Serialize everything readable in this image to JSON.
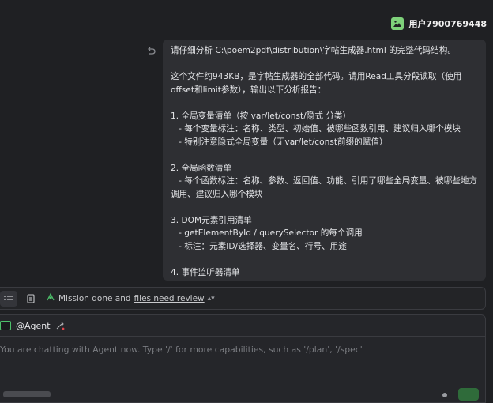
{
  "header": {
    "user_name": "用户7900769448",
    "avatar_icon": "image-icon"
  },
  "message": {
    "lines": [
      "请仔细分析 C:\\poem2pdf\\distribution\\字帖生成器.html 的完整代码结构。",
      "",
      "这个文件约943KB，是字帖生成器的全部代码。请用Read工具分段读取（使用offset和limit参数），输出以下分析报告：",
      "",
      "1. 全局变量清单（按 var/let/const/隐式 分类）",
      "   - 每个变量标注：名称、类型、初始值、被哪些函数引用、建议归入哪个模块",
      "   - 特别注意隐式全局变量（无var/let/const前缀的赋值）",
      "",
      "2. 全局函数清单",
      "   - 每个函数标注：名称、参数、返回值、功能、引用了哪些全局变量、被哪些地方调用、建议归入哪个模块",
      "",
      "3. DOM元素引用清单",
      "   - getElementById / querySelector 的每个调用",
      "   - 标注：元素ID/选择器、变量名、行号、用途",
      "",
      "4. 事件监听器清单"
    ]
  },
  "status_bar": {
    "text": "Mission done and",
    "link": "files need review",
    "chevron": "⌃"
  },
  "input": {
    "agent_label": "@Agent",
    "placeholder": "You are chatting with Agent now. Type '/' for more capabilities, such as '/plan', '/spec'"
  },
  "colors": {
    "accent": "#4cc06a",
    "avatar": "#7ed17a",
    "background": "#1f2023",
    "bubble": "#2e2f33"
  }
}
